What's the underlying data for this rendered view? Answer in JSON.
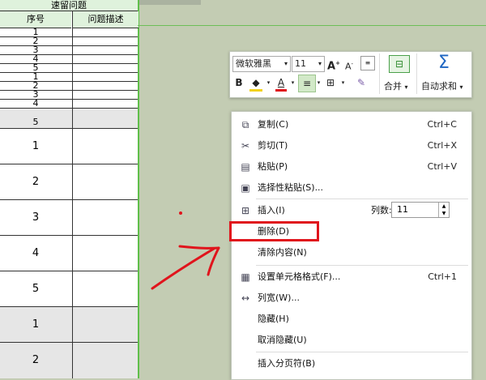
{
  "sheet": {
    "title": "速留问题",
    "col1": "序号",
    "col2": "问题描述",
    "small_rows": [
      "1",
      "2",
      "3",
      "4",
      "5",
      "1",
      "2",
      "3",
      "4",
      "5"
    ],
    "big_rows": [
      "1",
      "2",
      "3",
      "4",
      "5",
      "1",
      "2"
    ]
  },
  "toolbar": {
    "font_name": "微软雅黑",
    "font_size": "11",
    "merge_label": "合并",
    "autosum_label": "自动求和"
  },
  "menu": {
    "items": [
      {
        "label": "复制(C)",
        "shortcut": "Ctrl+C",
        "icon": "copy-icon"
      },
      {
        "label": "剪切(T)",
        "shortcut": "Ctrl+X",
        "icon": "cut-icon"
      },
      {
        "label": "粘贴(P)",
        "shortcut": "Ctrl+V",
        "icon": "paste-icon"
      },
      {
        "label": "选择性粘贴(S)...",
        "shortcut": "",
        "icon": "paste-special-icon"
      },
      {
        "label": "插入(I)",
        "shortcut": "",
        "icon": "insert-icon"
      },
      {
        "label": "删除(D)",
        "shortcut": "",
        "icon": ""
      },
      {
        "label": "清除内容(N)",
        "shortcut": "",
        "icon": ""
      },
      {
        "label": "设置单元格格式(F)...",
        "shortcut": "Ctrl+1",
        "icon": "format-cells-icon"
      },
      {
        "label": "列宽(W)...",
        "shortcut": "",
        "icon": "column-width-icon"
      },
      {
        "label": "隐藏(H)",
        "shortcut": "",
        "icon": ""
      },
      {
        "label": "取消隐藏(U)",
        "shortcut": "",
        "icon": ""
      },
      {
        "label": "插入分页符(B)",
        "shortcut": "",
        "icon": ""
      }
    ],
    "col_count_label": "列数:",
    "col_count_value": "11"
  },
  "colors": {
    "highlight": "#e0141c",
    "arrow": "#e0141c",
    "sheet_border": "#5fbf4a",
    "background": "#c3ccb3"
  }
}
